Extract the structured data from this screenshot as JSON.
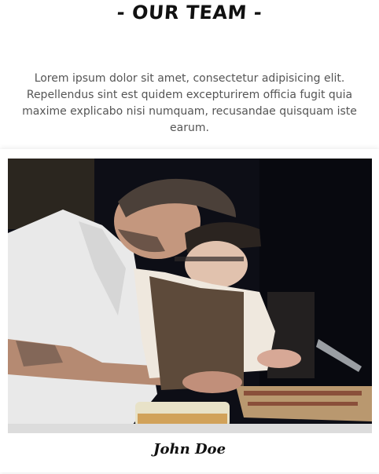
{
  "section": {
    "title": "- OUR TEAM -",
    "intro": "Lorem ipsum dolor sit amet, consectetur adipisicing elit. Repellendus sint est quidem excepturirem officia fugit quia maxime explicabo nisi numquam, recusandae quisquam iste earum."
  },
  "team": {
    "members": [
      {
        "name": "John Doe",
        "photo": "two-chefs-plating-photo"
      }
    ]
  }
}
